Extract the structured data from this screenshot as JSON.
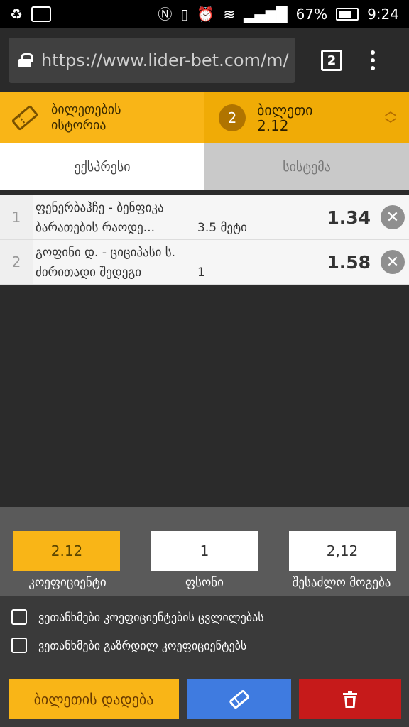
{
  "status_bar": {
    "battery": "67%",
    "time": "9:24"
  },
  "browser": {
    "url": "https://www.lider-bet.com/m/",
    "tab_count": "2"
  },
  "header": {
    "history_line1": "ბილეთების",
    "history_line2": "ისტორია",
    "ticket_count": "2",
    "ticket_title": "ბილეთი",
    "ticket_total_odds": "2.12"
  },
  "bet_type_tabs": {
    "express": "ექსპრესი",
    "system": "სისტემა"
  },
  "bets": [
    {
      "num": "1",
      "match": "ფენერბაჰჩე - ბენფიკა",
      "market": "ბარათების რაოდე...",
      "selection": "3.5 მეტი",
      "odd": "1.34"
    },
    {
      "num": "2",
      "match": "გოფინი დ. - ციციპასი ს.",
      "market": "ძირითადი შედეგი",
      "selection": "1",
      "odd": "1.58"
    }
  ],
  "stake": {
    "coefficient_value": "2.12",
    "coefficient_label": "კოეფიციენტი",
    "amount_value": "1",
    "amount_label": "ფსონი",
    "win_value": "2,12",
    "win_label": "შესაძლო მოგება"
  },
  "options": {
    "accept_odds_change": "ვეთანხმები კოეფიციენტების ცვლილებას",
    "accept_higher_odds": "ვეთანხმები გაზრდილ კოეფიციენტებს"
  },
  "actions": {
    "place_bet": "ბილეთის დადება"
  },
  "colors": {
    "accent": "#f9b517",
    "share": "#3f7be0",
    "delete": "#c61a1a"
  }
}
